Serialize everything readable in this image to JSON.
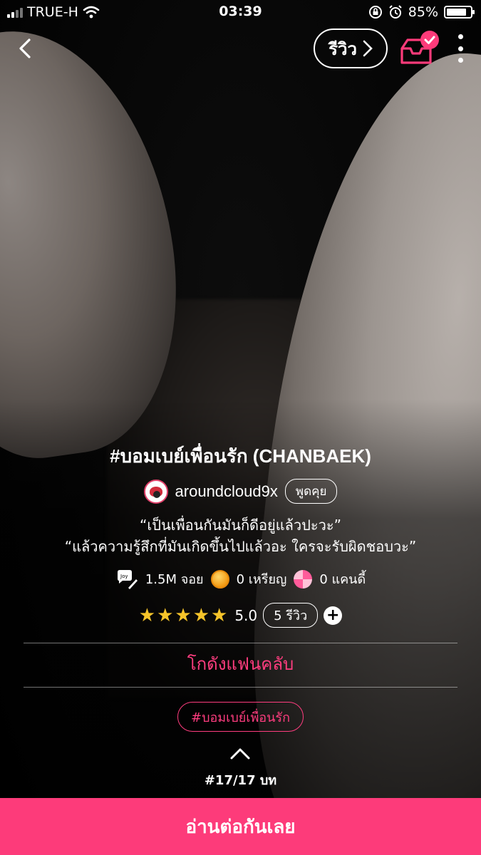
{
  "status_bar": {
    "carrier": "TRUE-H",
    "time": "03:39",
    "battery_percent": "85%",
    "battery_level": 0.85
  },
  "nav": {
    "review_label": "รีวิว",
    "shelf_icon": "bookshelf-check-icon",
    "accent_color": "#fd3b7a"
  },
  "story": {
    "title": "#บอมเบย์เพื่อนรัก (CHANBAEK)",
    "author": "aroundcloud9x",
    "talk_label": "พูดคุย",
    "description_line1": "“เป็นเพื่อนกันมันก็ดีอยู่แล้วปะวะ”",
    "description_line2": "“แล้วความรู้สึกที่มันเกิดขึ้นไปแล้วอะ ใครจะรับผิดชอบวะ”"
  },
  "stats": {
    "joy": "1.5M จอย",
    "coins": "0 เหรียญ",
    "candy": "0 แคนดี้"
  },
  "rating": {
    "stars": 5,
    "score": "5.0",
    "reviews": "5 รีวิว"
  },
  "fanclub_label": "โกดังแฟนคลับ",
  "tag": "#บอมเบย์เพื่อนรัก",
  "chapter": "#17/17 บท",
  "cta_label": "อ่านต่อกันเลย"
}
